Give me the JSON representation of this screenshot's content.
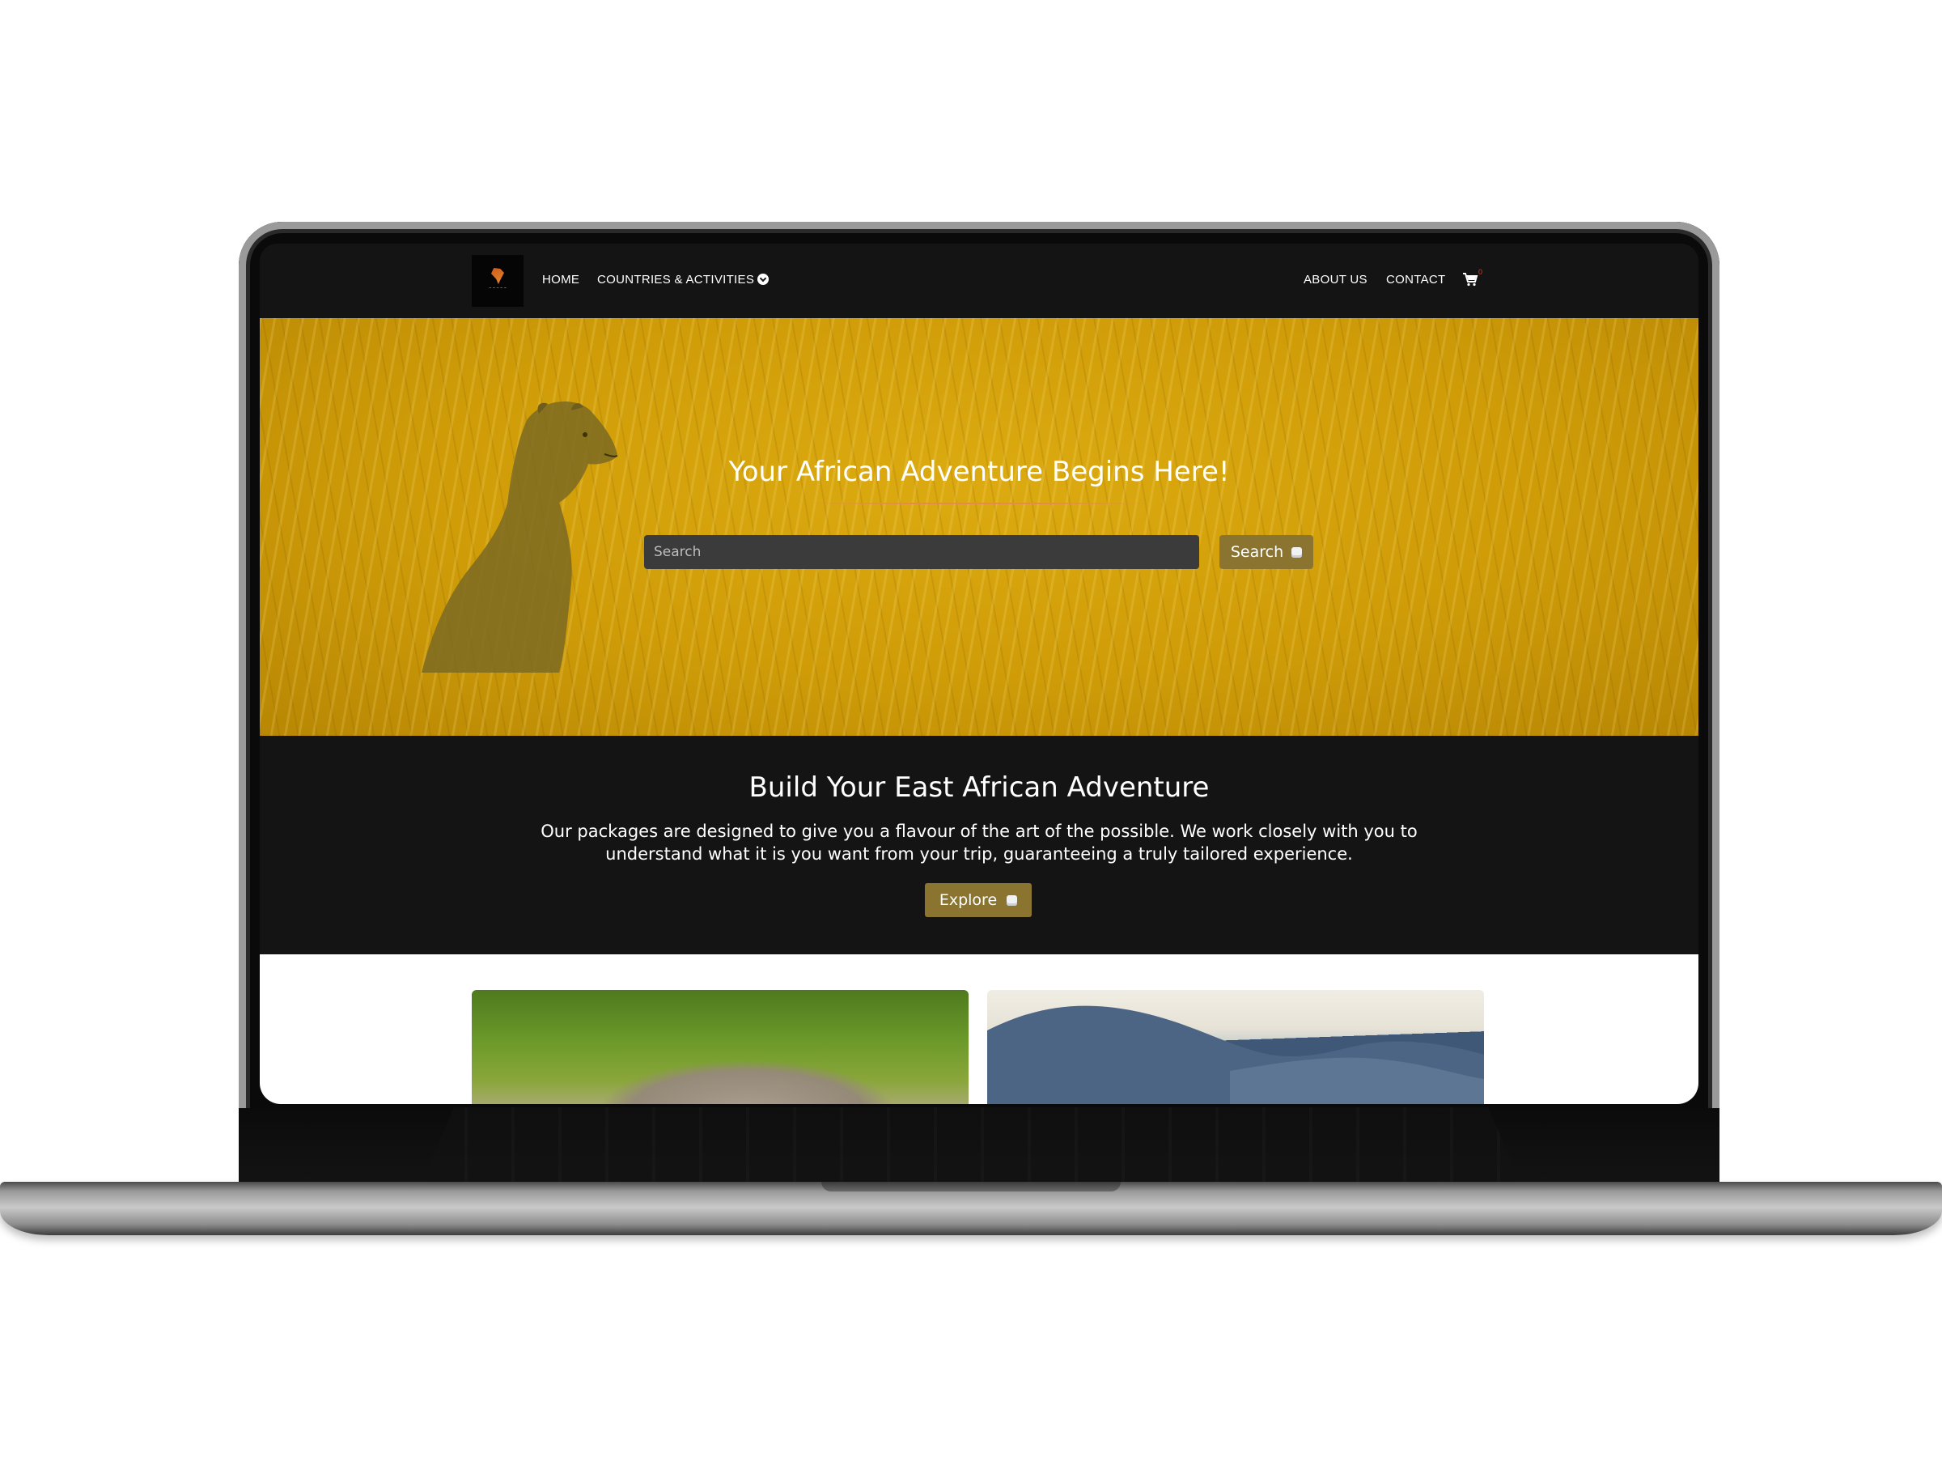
{
  "navbar": {
    "logo_alt": "Sunbeam East Africa",
    "items": [
      {
        "label": "HOME"
      },
      {
        "label": "COUNTRIES & ACTIVITIES"
      },
      {
        "label": "ABOUT US"
      },
      {
        "label": "CONTACT"
      }
    ],
    "cart_count": "0"
  },
  "hero": {
    "title": "Your African Adventure Begins Here!",
    "search_placeholder": "Search",
    "search_button": "Search"
  },
  "build": {
    "title": "Build Your East African Adventure",
    "text": "Our packages are designed to give you a flavour of the art of the possible. We work closely with you to understand what it is you want from your trip, guaranteeing a truly tailored experience.",
    "button": "Explore"
  },
  "colors": {
    "nav_bg": "#141414",
    "accent": "#8a7430",
    "hero_tint": "#d4a20c",
    "cart_badge": "#e2382b"
  },
  "icons": {
    "dropdown": "chevron-circle-down-icon",
    "cart": "shopping-cart-icon",
    "button": "square-icon"
  }
}
